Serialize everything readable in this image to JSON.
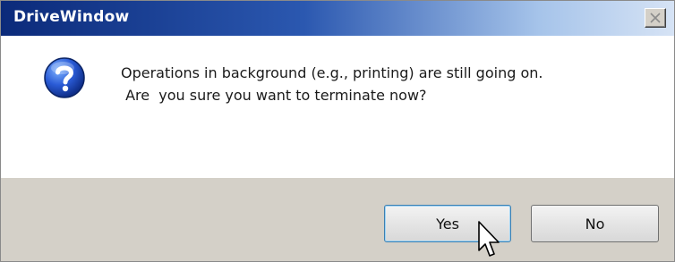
{
  "window": {
    "title": "DriveWindow",
    "close_icon": "close-icon"
  },
  "dialog": {
    "icon": "question-icon",
    "message": "Operations in background (e.g., printing) are still going on.\n Are  you sure you want to terminate now?"
  },
  "buttons": {
    "yes_label": "Yes",
    "no_label": "No"
  },
  "colors": {
    "titlebar_start": "#0b2a7a",
    "titlebar_end": "#d6e3f5",
    "footer_bg": "#d4d0c8",
    "icon_blue": "#2a5bd6"
  },
  "pointer": {
    "icon": "mouse-cursor-icon"
  }
}
